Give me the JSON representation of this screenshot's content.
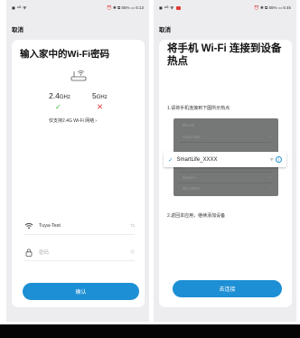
{
  "left_screen": {
    "status": {
      "left": "◼ ⁴ᴳ ᯤ",
      "right": "⏰ ✱ ⧉ 55% ▭ 5:13"
    },
    "cancel_label": "取消",
    "title": "输入家中的Wi-Fi密码",
    "band_24": {
      "value": "2.4",
      "unit": "GHz",
      "mark": "✓"
    },
    "band_5": {
      "value": "5",
      "unit": "GHz",
      "mark": "✕"
    },
    "support_text": "仅支持2.4G Wi-Fi 网络",
    "support_chevron": "›",
    "wifi_field": {
      "value": "Tuya-Test",
      "action": "⇆"
    },
    "password_field": {
      "placeholder": "密码",
      "action": "◎"
    },
    "confirm_label": "确认"
  },
  "right_screen": {
    "status": {
      "left": "◼ ⁴ᴳ ᯤ",
      "right": "⏰ ✱ ⧉ 55% ▭ 5:45"
    },
    "cancel_label": "取消",
    "title": "将手机 Wi-Fi 连接到设备热点",
    "step1": "1.请将手机连接到下图所示热点",
    "mock_rows": [
      {
        "label": "WLAN",
        "signal": ""
      },
      {
        "label": "Tuya-Test",
        "signal": "◔"
      },
      {
        "label": "",
        "signal": ""
      },
      {
        "label": "Tuya-Ext",
        "signal": "◔"
      },
      {
        "label": "Xiaomi",
        "signal": "◔"
      },
      {
        "label": "WLAN5G",
        "signal": "◔"
      }
    ],
    "hotspot": {
      "check": "✓",
      "name": "SmartLife_XXXX",
      "signal": "ᯤ",
      "info": "i"
    },
    "step2": "2.返回本应用，继续添加设备",
    "connect_label": "去连接"
  },
  "colors": {
    "accent": "#1d8fd4",
    "ok": "#3cc23c",
    "bad": "#e53935"
  }
}
